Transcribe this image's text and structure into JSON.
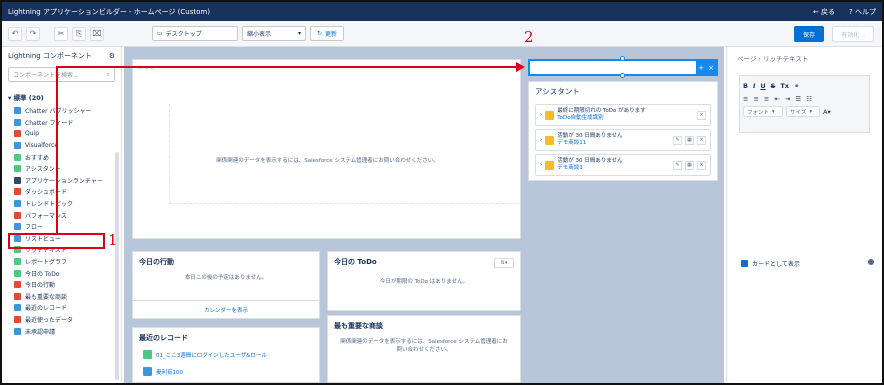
{
  "titlebar": {
    "title": "Lightning アプリケーションビルダー - ホームページ (Custom)",
    "back": "← 戻る",
    "help": "? ヘルプ"
  },
  "toolbar": {
    "device": "デスクトップ",
    "view": "縮小表示",
    "refresh": "更新",
    "save": "保存",
    "publish": "有効化..."
  },
  "left": {
    "title": "Lightning コンポーネント",
    "search_placeholder": "コンポーネントを検索...",
    "section": "標準 (20)",
    "items": [
      {
        "label": "Chatter パブリッシャー",
        "color": "#3c97dd"
      },
      {
        "label": "Chatter フィード",
        "color": "#3c97dd"
      },
      {
        "label": "Quip",
        "color": "#e44b37"
      },
      {
        "label": "Visualforce",
        "color": "#3c97dd"
      },
      {
        "label": "おすすめ",
        "color": "#4bca81"
      },
      {
        "label": "アシスタント",
        "color": "#4bca81"
      },
      {
        "label": "アプリケーションランチャー",
        "color": "#34495e"
      },
      {
        "label": "ダッシュボード",
        "color": "#e44b37"
      },
      {
        "label": "トレンドトピック",
        "color": "#3c97dd"
      },
      {
        "label": "パフォーマンス",
        "color": "#e44b37"
      },
      {
        "label": "フロー",
        "color": "#3c97dd"
      },
      {
        "label": "リストビュー",
        "color": "#3c97dd"
      },
      {
        "label": "リッチテキスト",
        "color": "#4bca81"
      },
      {
        "label": "レポートグラフ",
        "color": "#4bca81"
      },
      {
        "label": "今日の ToDo",
        "color": "#4bca81"
      },
      {
        "label": "今日の行動",
        "color": "#e44b37"
      },
      {
        "label": "最も重要な商談",
        "color": "#e44b37"
      },
      {
        "label": "最近のレコード",
        "color": "#3c97dd"
      },
      {
        "label": "最近使ったデータ",
        "color": "#e44b37"
      },
      {
        "label": "未承認申請",
        "color": "#3c97dd"
      }
    ]
  },
  "canvas": {
    "perf_msg": "関係関連のデータを表示するには、Salesforce システム管理者にお問い合わせください。",
    "today_events": {
      "title": "今日の行動",
      "empty": "本日この後の予定はありません。",
      "footer": "カレンダーを表示"
    },
    "today_todo": {
      "title": "今日の ToDo",
      "empty": "今日が期限の ToDo はありません。"
    },
    "top_deals": {
      "title": "最も重要な商談",
      "empty": "関係関連のデータを表示するには、Salesforce システム管理者にお問い合わせください。"
    },
    "recent": {
      "title": "最近のレコード",
      "items": [
        "01_ここ3週間にログインしたユーザ&ロール",
        "妻利有100"
      ]
    },
    "assistant": {
      "title": "アシスタント",
      "items": [
        {
          "text": "最終に期限切れの ToDo があります",
          "link": "ToDo自動生成識別"
        },
        {
          "text": "活動が 30 日間ありません",
          "link": "デモ商談11"
        },
        {
          "text": "活動が 30 日間ありません",
          "link": "デモ商談3"
        }
      ]
    }
  },
  "right": {
    "breadcrumb": "ページ › リッチテキスト",
    "font": "フォント",
    "size": "サイズ",
    "checkbox": "カードとして表示"
  },
  "annotations": {
    "one": "1",
    "two": "2"
  }
}
